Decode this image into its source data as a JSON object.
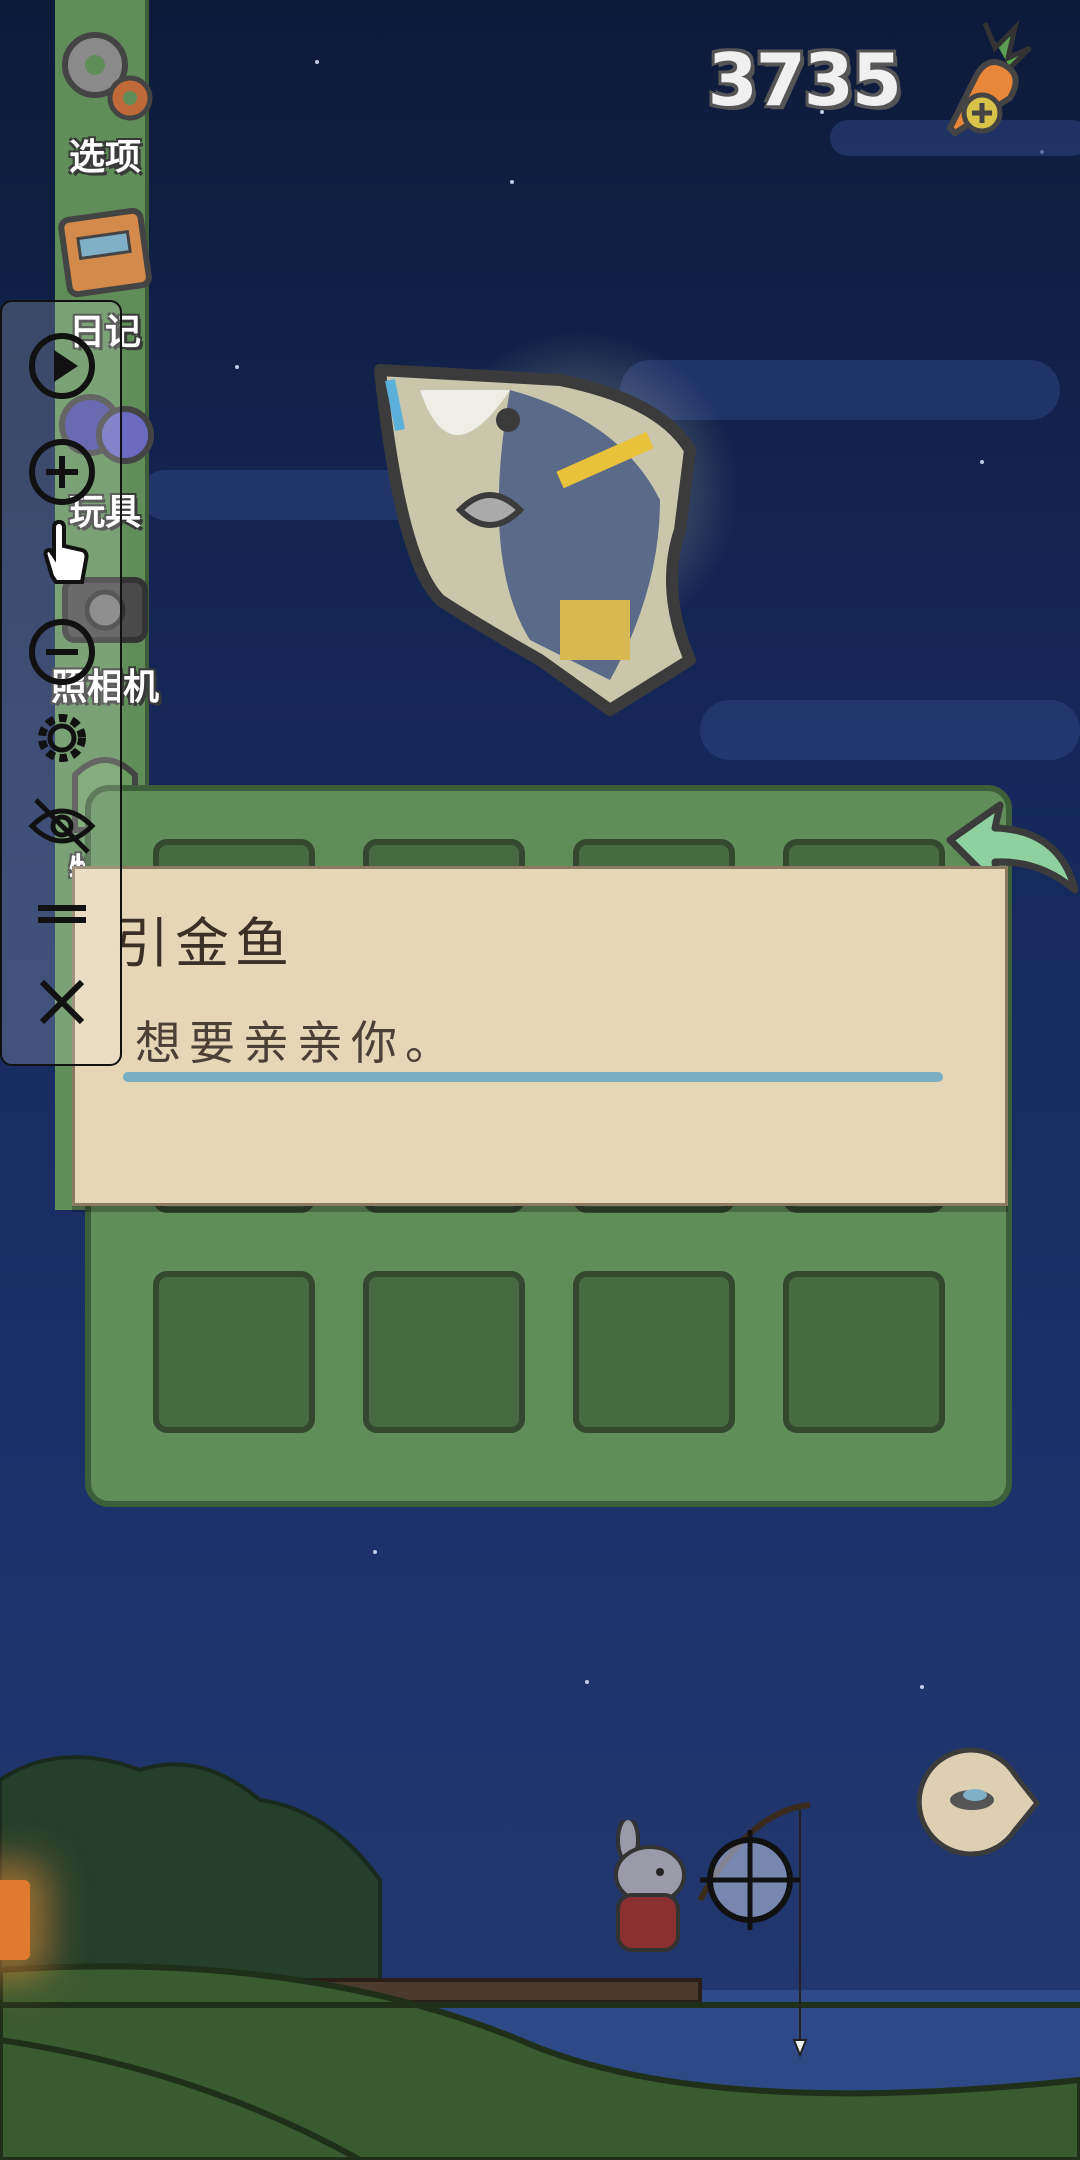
{
  "currency": {
    "carrots": "3735"
  },
  "sidebar": {
    "items": [
      {
        "label": "选项",
        "icon": "gear-icon"
      },
      {
        "label": "日记",
        "icon": "diary-icon"
      },
      {
        "label": "玩具",
        "icon": "toy-icon"
      },
      {
        "label": "照相机",
        "icon": "camera-icon"
      },
      {
        "label": "物品",
        "icon": "bag-icon"
      }
    ]
  },
  "dialog": {
    "title": "引金鱼",
    "text": "想要亲亲你。"
  },
  "overlay_controls": [
    {
      "name": "play-icon"
    },
    {
      "name": "zoom-in-icon"
    },
    {
      "name": "touch-icon"
    },
    {
      "name": "zoom-out-icon"
    },
    {
      "name": "settings-icon"
    },
    {
      "name": "hide-icon"
    },
    {
      "name": "menu-icon"
    },
    {
      "name": "close-icon"
    }
  ],
  "colors": {
    "sky": "#16285a",
    "panel_green": "#5f8e58",
    "dialog_bg": "#e5d6b6",
    "accent_bar": "#79adc2"
  }
}
